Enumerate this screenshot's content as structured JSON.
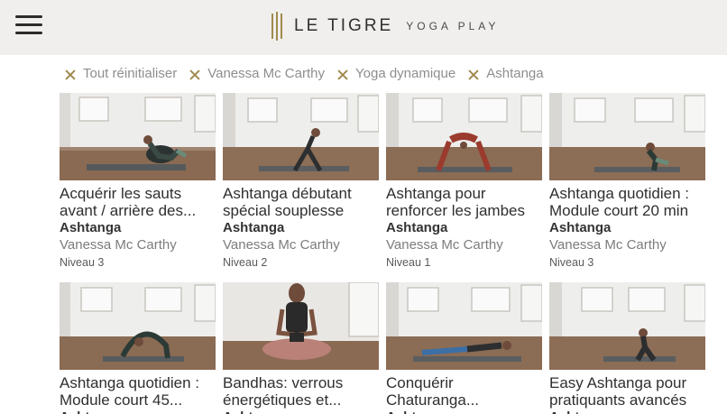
{
  "header": {
    "menu_icon": "hamburger-menu-icon",
    "brand": "LE TIGRE",
    "brand_sub": "YOGA PLAY",
    "accent_color": "#a08a4e"
  },
  "filters": [
    {
      "label": "Tout réinitialiser"
    },
    {
      "label": "Vanessa Mc Carthy"
    },
    {
      "label": "Yoga dynamique"
    },
    {
      "label": "Ashtanga"
    }
  ],
  "cards": [
    {
      "title": "Acquérir les sauts avant / arrière des...",
      "style": "Ashtanga",
      "teacher": "Vanessa Mc Carthy",
      "level": "Niveau 3"
    },
    {
      "title": "Ashtanga débutant spécial souplesse",
      "style": "Ashtanga",
      "teacher": "Vanessa Mc Carthy",
      "level": "Niveau 2"
    },
    {
      "title": "Ashtanga pour renforcer les jambes",
      "style": "Ashtanga",
      "teacher": "Vanessa Mc Carthy",
      "level": "Niveau 1"
    },
    {
      "title": "Ashtanga quotidien : Module court 20 min",
      "style": "Ashtanga",
      "teacher": "Vanessa Mc Carthy",
      "level": "Niveau 3"
    },
    {
      "title": "Ashtanga quotidien : Module court 45...",
      "style": "Asht",
      "teacher": "",
      "level": ""
    },
    {
      "title": "Bandhas: verrous énergétiques et...",
      "style": "Asht",
      "teacher": "",
      "level": ""
    },
    {
      "title": "Conquérir Chaturanga...",
      "style": "Asht",
      "teacher": "",
      "level": ""
    },
    {
      "title": "Easy Ashtanga pour pratiquants avancés",
      "style": "Asht",
      "teacher": "",
      "level": ""
    }
  ]
}
